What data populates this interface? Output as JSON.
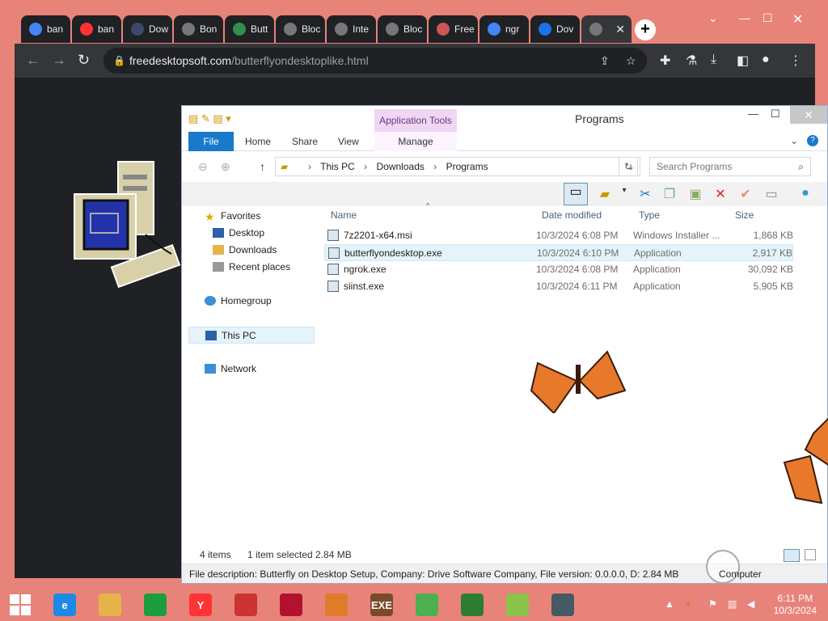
{
  "browser": {
    "tabs": [
      {
        "label": "ban",
        "favicon": "google-icon",
        "color": "#4285f4"
      },
      {
        "label": "ban",
        "favicon": "yandex-icon",
        "color": "#ff3333"
      },
      {
        "label": "Dow",
        "favicon": "re-icon",
        "color": "#3b4a6b"
      },
      {
        "label": "Bon",
        "favicon": "globe-icon",
        "color": "#777777"
      },
      {
        "label": "Butt",
        "favicon": "s-icon",
        "color": "#2f8f4f"
      },
      {
        "label": "Bloc",
        "favicon": "globe-icon",
        "color": "#777777"
      },
      {
        "label": "Inte",
        "favicon": "globe-icon",
        "color": "#777777"
      },
      {
        "label": "Bloc",
        "favicon": "globe-icon",
        "color": "#777777"
      },
      {
        "label": "Free",
        "favicon": "pc-icon",
        "color": "#cc5555"
      },
      {
        "label": "ngr",
        "favicon": "google-icon",
        "color": "#4285f4"
      },
      {
        "label": "Dov",
        "favicon": "q-icon",
        "color": "#1a73e8"
      },
      {
        "label": "",
        "favicon": "globe-icon",
        "color": "#777777"
      }
    ],
    "url_domain": "freedesktopsoft.com",
    "url_path": "/butterflyondesktoplike.html"
  },
  "explorer": {
    "title": "Programs",
    "app_tools_label": "Application Tools",
    "ribbon_tabs": [
      "File",
      "Home",
      "Share",
      "View",
      "Manage"
    ],
    "breadcrumb": [
      "This PC",
      "Downloads",
      "Programs"
    ],
    "search_placeholder": "Search Programs",
    "nav": {
      "favorites": "Favorites",
      "desktop": "Desktop",
      "downloads": "Downloads",
      "recent": "Recent places",
      "homegroup": "Homegroup",
      "thispc": "This PC",
      "network": "Network"
    },
    "columns": {
      "name": "Name",
      "date": "Date modified",
      "type": "Type",
      "size": "Size"
    },
    "files": [
      {
        "name": "7z2201-x64.msi",
        "date": "10/3/2024 6:08 PM",
        "type": "Windows Installer ...",
        "size": "1,868 KB"
      },
      {
        "name": "butterflyondesktop.exe",
        "date": "10/3/2024 6:10 PM",
        "type": "Application",
        "size": "2,917 KB"
      },
      {
        "name": "ngrok.exe",
        "date": "10/3/2024 6:08 PM",
        "type": "Application",
        "size": "30,092 KB"
      },
      {
        "name": "siinst.exe",
        "date": "10/3/2024 6:11 PM",
        "type": "Application",
        "size": "5,905 KB"
      }
    ],
    "status": {
      "count": "4 items",
      "selected": "1 item selected  2.84 MB"
    },
    "description": "File description: Butterfly on Desktop Setup, Company: Drive Software Company, File version: 0.0.0.0, D: 2.84 MB",
    "location": "Computer"
  },
  "taskbar": {
    "apps": [
      {
        "name": "ie",
        "glyph": "e",
        "color": "#1e88e5"
      },
      {
        "name": "explorer",
        "glyph": "",
        "color": "#e6b34a"
      },
      {
        "name": "store",
        "glyph": "",
        "color": "#1b9e3e"
      },
      {
        "name": "yandex",
        "glyph": "Y",
        "color": "#ff3333"
      },
      {
        "name": "app-red",
        "glyph": "",
        "color": "#cc3333"
      },
      {
        "name": "opera",
        "glyph": "",
        "color": "#b3122f"
      },
      {
        "name": "app-orange",
        "glyph": "",
        "color": "#e07b2a"
      },
      {
        "name": "youtube-exe",
        "glyph": "EXE",
        "color": "#7a4a2a"
      },
      {
        "name": "chrome",
        "glyph": "",
        "color": "#4caf50"
      },
      {
        "name": "idm",
        "glyph": "",
        "color": "#2e7d32"
      },
      {
        "name": "app-green",
        "glyph": "",
        "color": "#8bc34a"
      },
      {
        "name": "app-window",
        "glyph": "",
        "color": "#455a64"
      }
    ],
    "time": "6:11 PM",
    "date": "10/3/2024"
  }
}
